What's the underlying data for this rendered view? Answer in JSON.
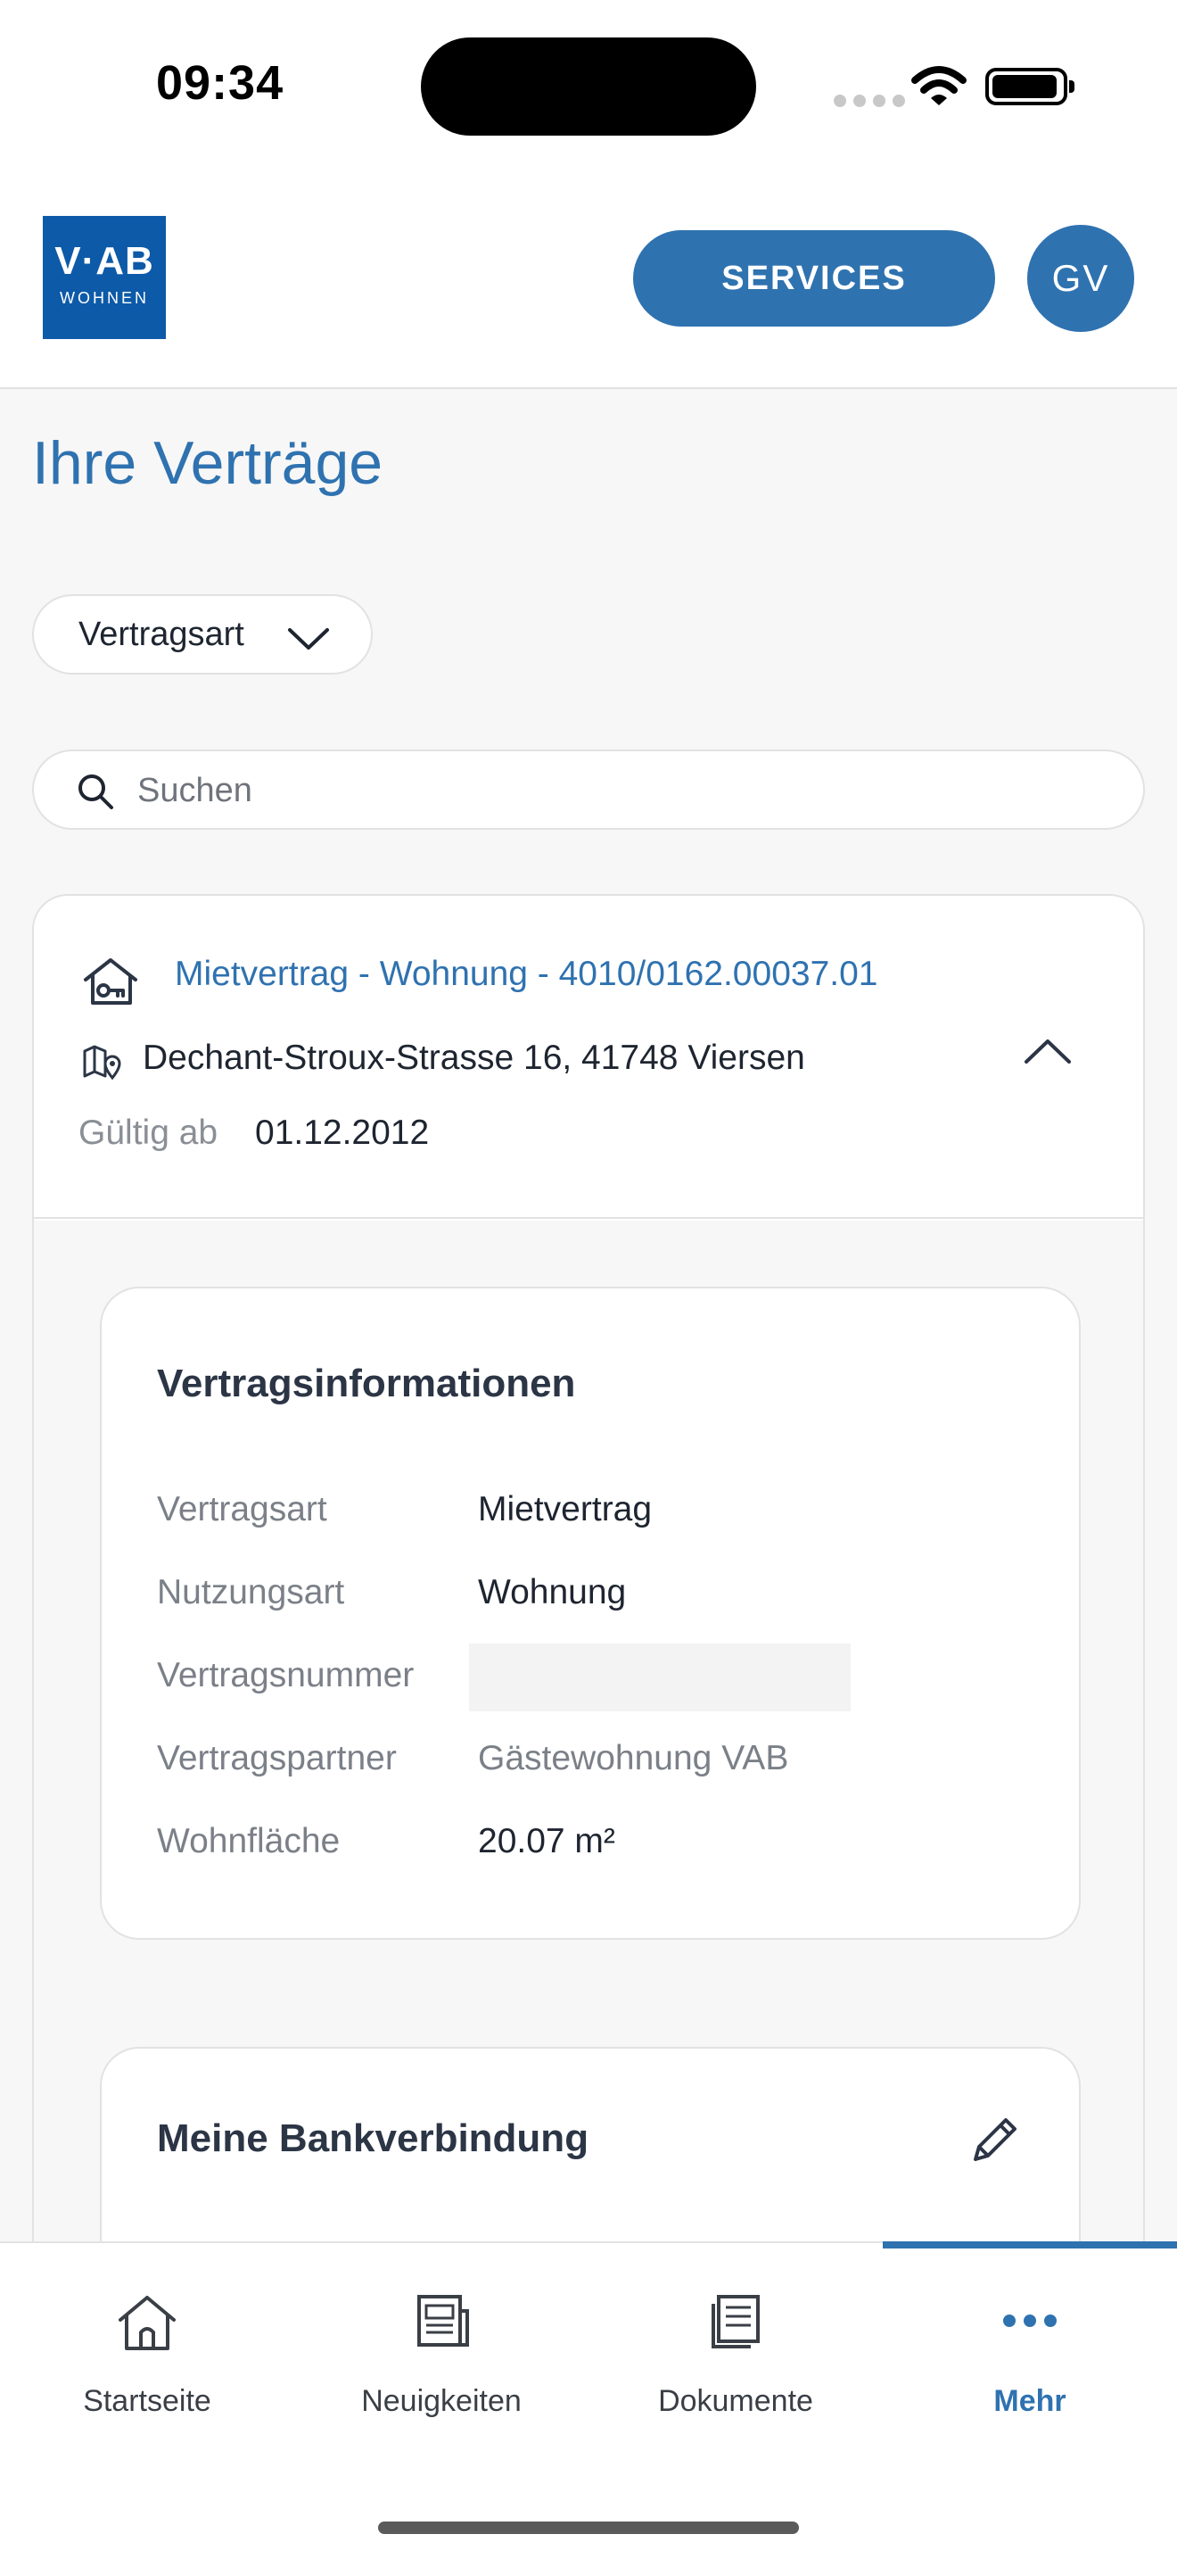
{
  "status_bar": {
    "time": "09:34"
  },
  "header": {
    "logo_line1": "V·AB",
    "logo_line2": "WOHNEN",
    "services_label": "SERVICES",
    "avatar_initials": "GV"
  },
  "page": {
    "title": "Ihre Verträge",
    "filter_label": "Vertragsart",
    "search_placeholder": "Suchen"
  },
  "contract": {
    "title": "Mietvertrag - Wohnung - 4010/0162.00037.01",
    "address": "Dechant-Stroux-Strasse 16, 41748 Viersen",
    "valid_from_label": "Gültig ab",
    "valid_from_value": "01.12.2012"
  },
  "contract_info": {
    "title": "Vertragsinformationen",
    "rows": [
      {
        "label": "Vertragsart",
        "value": "Mietvertrag"
      },
      {
        "label": "Nutzungsart",
        "value": "Wohnung"
      },
      {
        "label": "Vertragsnummer",
        "value": ""
      },
      {
        "label": "Vertragspartner",
        "value": "Gästewohnung VAB"
      },
      {
        "label": "Wohnfläche",
        "value": "20.07 m²"
      }
    ]
  },
  "bank": {
    "title": "Meine Bankverbindung"
  },
  "tabs": [
    {
      "label": "Startseite",
      "icon": "home-icon"
    },
    {
      "label": "Neuigkeiten",
      "icon": "news-icon"
    },
    {
      "label": "Dokumente",
      "icon": "document-icon"
    },
    {
      "label": "Mehr",
      "icon": "more-icon",
      "active": true
    }
  ],
  "colors": {
    "accent": "#2f72b0",
    "logo": "#0d5aa8"
  }
}
